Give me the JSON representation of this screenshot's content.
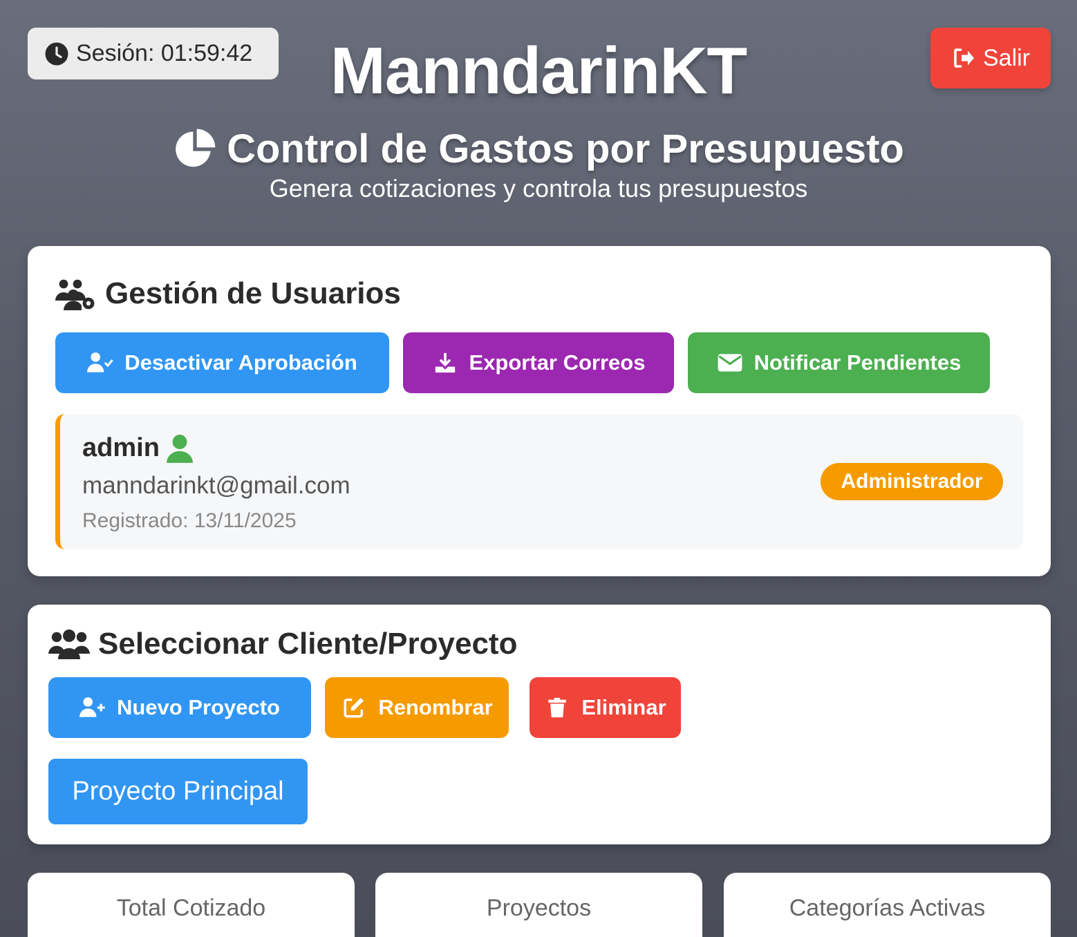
{
  "session": {
    "label": "Sesión: 01:59:42",
    "icon": "clock-icon"
  },
  "logout": {
    "label": "Salir",
    "icon": "sign-out-icon"
  },
  "header": {
    "title": "ManndarinKT",
    "subtitle": "Control de Gastos por Presupuesto",
    "subtitle_icon": "pie-chart-icon",
    "tagline": "Genera cotizaciones y controla tus presupuestos"
  },
  "users_card": {
    "title": "Gestión de Usuarios",
    "icon": "users-gear-icon",
    "buttons": [
      {
        "label": "Desactivar Aprobación",
        "icon": "user-check-icon",
        "color": "#3196f3"
      },
      {
        "label": "Exportar Correos",
        "icon": "download-icon",
        "color": "#9c27b0"
      },
      {
        "label": "Notificar Pendientes",
        "icon": "envelope-icon",
        "color": "#4caf50"
      }
    ],
    "user": {
      "name": "admin",
      "email": "manndarinkt@gmail.com",
      "registered": "Registrado: 13/11/2025",
      "role": "Administrador"
    }
  },
  "projects_card": {
    "title": "Seleccionar Cliente/Proyecto",
    "icon": "users-icon",
    "buttons": [
      {
        "label": "Nuevo Proyecto",
        "icon": "user-plus-icon",
        "color": "#3196f3"
      },
      {
        "label": "Renombrar",
        "icon": "edit-icon",
        "color": "#f59b00"
      },
      {
        "label": "Eliminar",
        "icon": "trash-icon",
        "color": "#f0443a"
      }
    ],
    "projects": [
      "Proyecto Principal"
    ]
  },
  "stats": [
    {
      "label": "Total Cotizado"
    },
    {
      "label": "Proyectos"
    },
    {
      "label": "Categorías Activas"
    }
  ]
}
